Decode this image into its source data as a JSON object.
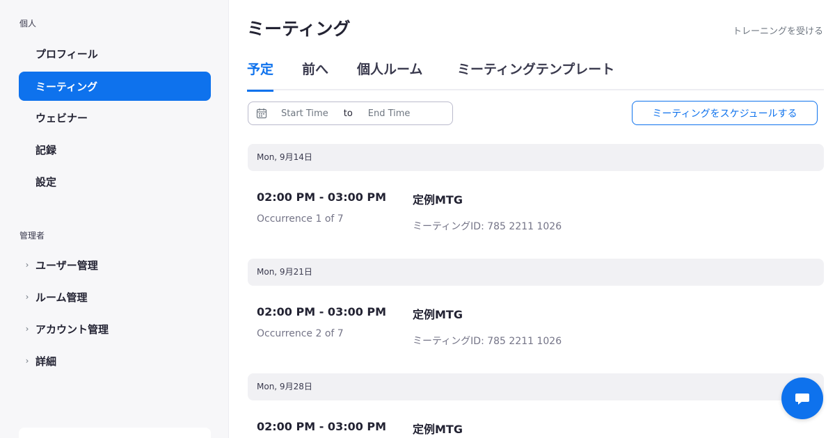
{
  "sidebar": {
    "personal_label": "個人",
    "personal_items": [
      {
        "label": "プロフィール"
      },
      {
        "label": "ミーティング"
      },
      {
        "label": "ウェビナー"
      },
      {
        "label": "記録"
      },
      {
        "label": "設定"
      }
    ],
    "admin_label": "管理者",
    "admin_items": [
      {
        "label": "ユーザー管理"
      },
      {
        "label": "ルーム管理"
      },
      {
        "label": "アカウント管理"
      },
      {
        "label": "詳細"
      }
    ]
  },
  "main": {
    "title": "ミーティング",
    "training_link": "トレーニングを受ける",
    "tabs": [
      {
        "label": "予定"
      },
      {
        "label": "前へ"
      },
      {
        "label": "個人ルーム"
      },
      {
        "label": "ミーティングテンプレート"
      }
    ],
    "date_range": {
      "start": "Start Time",
      "to": "to",
      "end": "End Time"
    },
    "schedule_button": "ミーティングをスケジュールする",
    "days": [
      {
        "date": "Mon, 9月14日",
        "time": "02:00 PM - 03:00 PM",
        "occurrence": "Occurrence 1 of 7",
        "title": "定例MTG",
        "meeting_id": "ミーティングID: 785 2211 1026"
      },
      {
        "date": "Mon, 9月21日",
        "time": "02:00 PM - 03:00 PM",
        "occurrence": "Occurrence 2 of 7",
        "title": "定例MTG",
        "meeting_id": "ミーティングID: 785 2211 1026"
      },
      {
        "date": "Mon, 9月28日",
        "time": "02:00 PM - 03:00 PM",
        "title": "定例MTG"
      }
    ]
  },
  "colors": {
    "accent": "#0e72ed",
    "sidebar_bg": "#f7f7f9",
    "day_header_bg": "#f1f1f4"
  },
  "icons": {
    "calendar": "calendar-icon",
    "chevron": "chevron-right-icon",
    "chat": "chat-icon"
  }
}
